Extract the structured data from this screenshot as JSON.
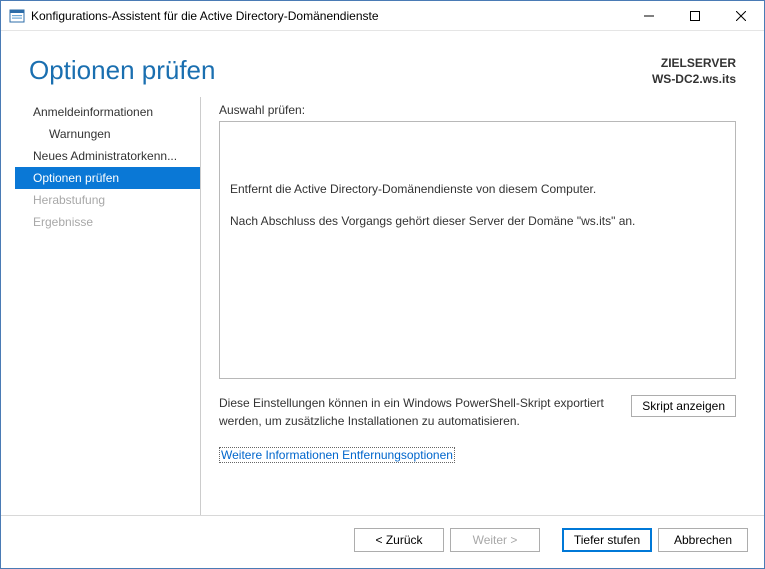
{
  "window": {
    "title": "Konfigurations-Assistent für die Active Directory-Domänendienste"
  },
  "header": {
    "page_title": "Optionen prüfen",
    "target_label": "ZIELSERVER",
    "target_value": "WS-DC2.ws.its"
  },
  "sidebar": {
    "items": [
      {
        "label": "Anmeldeinformationen",
        "state": "normal",
        "indent": false
      },
      {
        "label": "Warnungen",
        "state": "normal",
        "indent": true
      },
      {
        "label": "Neues Administratorkenn...",
        "state": "normal",
        "indent": false
      },
      {
        "label": "Optionen prüfen",
        "state": "active",
        "indent": false
      },
      {
        "label": "Herabstufung",
        "state": "disabled",
        "indent": false
      },
      {
        "label": "Ergebnisse",
        "state": "disabled",
        "indent": false
      }
    ]
  },
  "content": {
    "review_label": "Auswahl prüfen:",
    "review_lines": [
      "Entfernt die Active Directory-Domänendienste von diesem Computer.",
      "Nach Abschluss des Vorgangs gehört dieser Server der Domäne \"ws.its\" an."
    ],
    "export_text": "Diese Einstellungen können in ein Windows PowerShell-Skript exportiert werden, um zusätzliche Installationen zu automatisieren.",
    "view_script_label": "Skript anzeigen",
    "more_link_label": "Weitere Informationen Entfernungsoptionen"
  },
  "footer": {
    "back_label": "< Zurück",
    "next_label": "Weiter >",
    "demote_label": "Tiefer stufen",
    "cancel_label": "Abbrechen"
  }
}
